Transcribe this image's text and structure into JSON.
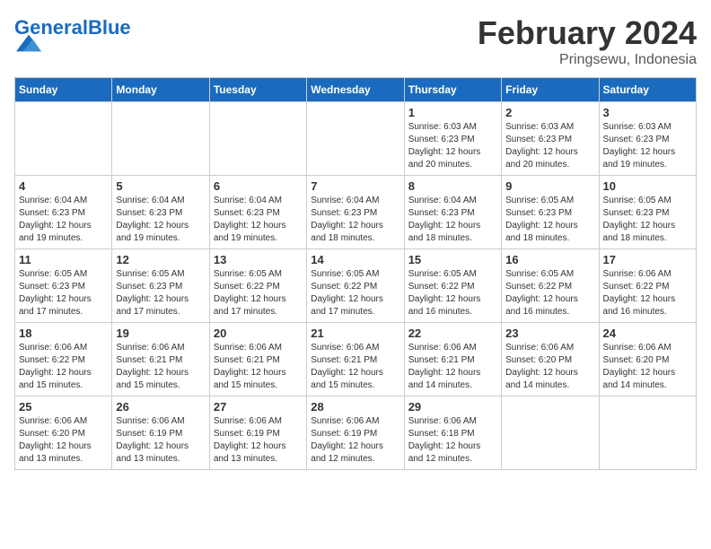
{
  "header": {
    "logo_general": "General",
    "logo_blue": "Blue",
    "month_year": "February 2024",
    "location": "Pringsewu, Indonesia"
  },
  "days_of_week": [
    "Sunday",
    "Monday",
    "Tuesday",
    "Wednesday",
    "Thursday",
    "Friday",
    "Saturday"
  ],
  "weeks": [
    [
      {
        "num": "",
        "detail": ""
      },
      {
        "num": "",
        "detail": ""
      },
      {
        "num": "",
        "detail": ""
      },
      {
        "num": "",
        "detail": ""
      },
      {
        "num": "1",
        "detail": "Sunrise: 6:03 AM\nSunset: 6:23 PM\nDaylight: 12 hours\nand 20 minutes."
      },
      {
        "num": "2",
        "detail": "Sunrise: 6:03 AM\nSunset: 6:23 PM\nDaylight: 12 hours\nand 20 minutes."
      },
      {
        "num": "3",
        "detail": "Sunrise: 6:03 AM\nSunset: 6:23 PM\nDaylight: 12 hours\nand 19 minutes."
      }
    ],
    [
      {
        "num": "4",
        "detail": "Sunrise: 6:04 AM\nSunset: 6:23 PM\nDaylight: 12 hours\nand 19 minutes."
      },
      {
        "num": "5",
        "detail": "Sunrise: 6:04 AM\nSunset: 6:23 PM\nDaylight: 12 hours\nand 19 minutes."
      },
      {
        "num": "6",
        "detail": "Sunrise: 6:04 AM\nSunset: 6:23 PM\nDaylight: 12 hours\nand 19 minutes."
      },
      {
        "num": "7",
        "detail": "Sunrise: 6:04 AM\nSunset: 6:23 PM\nDaylight: 12 hours\nand 18 minutes."
      },
      {
        "num": "8",
        "detail": "Sunrise: 6:04 AM\nSunset: 6:23 PM\nDaylight: 12 hours\nand 18 minutes."
      },
      {
        "num": "9",
        "detail": "Sunrise: 6:05 AM\nSunset: 6:23 PM\nDaylight: 12 hours\nand 18 minutes."
      },
      {
        "num": "10",
        "detail": "Sunrise: 6:05 AM\nSunset: 6:23 PM\nDaylight: 12 hours\nand 18 minutes."
      }
    ],
    [
      {
        "num": "11",
        "detail": "Sunrise: 6:05 AM\nSunset: 6:23 PM\nDaylight: 12 hours\nand 17 minutes."
      },
      {
        "num": "12",
        "detail": "Sunrise: 6:05 AM\nSunset: 6:23 PM\nDaylight: 12 hours\nand 17 minutes."
      },
      {
        "num": "13",
        "detail": "Sunrise: 6:05 AM\nSunset: 6:22 PM\nDaylight: 12 hours\nand 17 minutes."
      },
      {
        "num": "14",
        "detail": "Sunrise: 6:05 AM\nSunset: 6:22 PM\nDaylight: 12 hours\nand 17 minutes."
      },
      {
        "num": "15",
        "detail": "Sunrise: 6:05 AM\nSunset: 6:22 PM\nDaylight: 12 hours\nand 16 minutes."
      },
      {
        "num": "16",
        "detail": "Sunrise: 6:05 AM\nSunset: 6:22 PM\nDaylight: 12 hours\nand 16 minutes."
      },
      {
        "num": "17",
        "detail": "Sunrise: 6:06 AM\nSunset: 6:22 PM\nDaylight: 12 hours\nand 16 minutes."
      }
    ],
    [
      {
        "num": "18",
        "detail": "Sunrise: 6:06 AM\nSunset: 6:22 PM\nDaylight: 12 hours\nand 15 minutes."
      },
      {
        "num": "19",
        "detail": "Sunrise: 6:06 AM\nSunset: 6:21 PM\nDaylight: 12 hours\nand 15 minutes."
      },
      {
        "num": "20",
        "detail": "Sunrise: 6:06 AM\nSunset: 6:21 PM\nDaylight: 12 hours\nand 15 minutes."
      },
      {
        "num": "21",
        "detail": "Sunrise: 6:06 AM\nSunset: 6:21 PM\nDaylight: 12 hours\nand 15 minutes."
      },
      {
        "num": "22",
        "detail": "Sunrise: 6:06 AM\nSunset: 6:21 PM\nDaylight: 12 hours\nand 14 minutes."
      },
      {
        "num": "23",
        "detail": "Sunrise: 6:06 AM\nSunset: 6:20 PM\nDaylight: 12 hours\nand 14 minutes."
      },
      {
        "num": "24",
        "detail": "Sunrise: 6:06 AM\nSunset: 6:20 PM\nDaylight: 12 hours\nand 14 minutes."
      }
    ],
    [
      {
        "num": "25",
        "detail": "Sunrise: 6:06 AM\nSunset: 6:20 PM\nDaylight: 12 hours\nand 13 minutes."
      },
      {
        "num": "26",
        "detail": "Sunrise: 6:06 AM\nSunset: 6:19 PM\nDaylight: 12 hours\nand 13 minutes."
      },
      {
        "num": "27",
        "detail": "Sunrise: 6:06 AM\nSunset: 6:19 PM\nDaylight: 12 hours\nand 13 minutes."
      },
      {
        "num": "28",
        "detail": "Sunrise: 6:06 AM\nSunset: 6:19 PM\nDaylight: 12 hours\nand 12 minutes."
      },
      {
        "num": "29",
        "detail": "Sunrise: 6:06 AM\nSunset: 6:18 PM\nDaylight: 12 hours\nand 12 minutes."
      },
      {
        "num": "",
        "detail": ""
      },
      {
        "num": "",
        "detail": ""
      }
    ]
  ]
}
